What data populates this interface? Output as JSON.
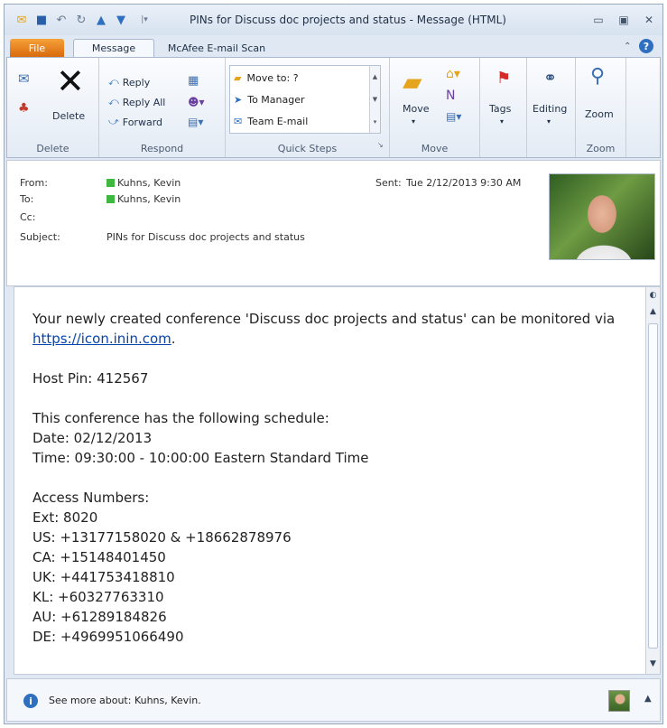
{
  "window": {
    "title": "PINs for Discuss doc projects and status - Message (HTML)",
    "controls": {
      "minimize": "▭",
      "maximize": "▣",
      "close": "✕"
    }
  },
  "tabs": [
    {
      "label": "File"
    },
    {
      "label": "Message"
    },
    {
      "label": "McAfee E-mail Scan"
    }
  ],
  "ribbon": {
    "groups": {
      "delete": "Delete",
      "respond": "Respond",
      "quick_steps": "Quick Steps",
      "move": "Move",
      "zoom": "Zoom"
    },
    "buttons": {
      "delete": "Delete",
      "reply": "Reply",
      "reply_all": "Reply All",
      "forward": "Forward",
      "move": "Move",
      "tags": "Tags",
      "editing": "Editing",
      "zoom": "Zoom"
    },
    "quick_steps": [
      {
        "label": "Move to: ?"
      },
      {
        "label": "To Manager"
      },
      {
        "label": "Team E-mail"
      }
    ]
  },
  "header": {
    "labels": {
      "from": "From:",
      "to": "To:",
      "cc": "Cc:",
      "subject": "Subject:",
      "sent": "Sent:"
    },
    "from": "Kuhns, Kevin",
    "to": "Kuhns, Kevin",
    "cc": "",
    "subject": "PINs for Discuss doc projects and status",
    "sent": "Tue 2/12/2013 9:30 AM"
  },
  "body": {
    "intro_before": "Your newly created conference 'Discuss doc projects and status' can be monitored via ",
    "link": "https://icon.inin.com",
    "intro_after": ".",
    "host_pin": "Host Pin: 412567",
    "schedule_header": "This conference has the following schedule:",
    "date": "Date: 02/12/2013",
    "time": "Time: 09:30:00 - 10:00:00 Eastern Standard Time",
    "access_header": "Access Numbers:",
    "numbers": [
      "Ext: 8020",
      "US: +13177158020 & +18662878976",
      "CA: +15148401450",
      "UK: +441753418810",
      "KL: +60327763310",
      "AU: +61289184826",
      "DE: +4969951066490"
    ]
  },
  "social": {
    "see_more": "See more about: Kuhns, Kevin."
  },
  "icons": {
    "app": "outlook-envelope-icon",
    "save": "save-icon",
    "undo": "undo-icon",
    "redo": "redo-icon",
    "prev": "previous-item-icon",
    "next": "next-item-icon",
    "customize": "customize-toolbar-icon",
    "help": "help-icon",
    "minimize_ribbon": "minimize-ribbon-icon"
  },
  "colors": {
    "file_tab": "#e87b1c",
    "link": "#0645ad",
    "presence": "#3fb83f",
    "info": "#2f6fc0"
  }
}
